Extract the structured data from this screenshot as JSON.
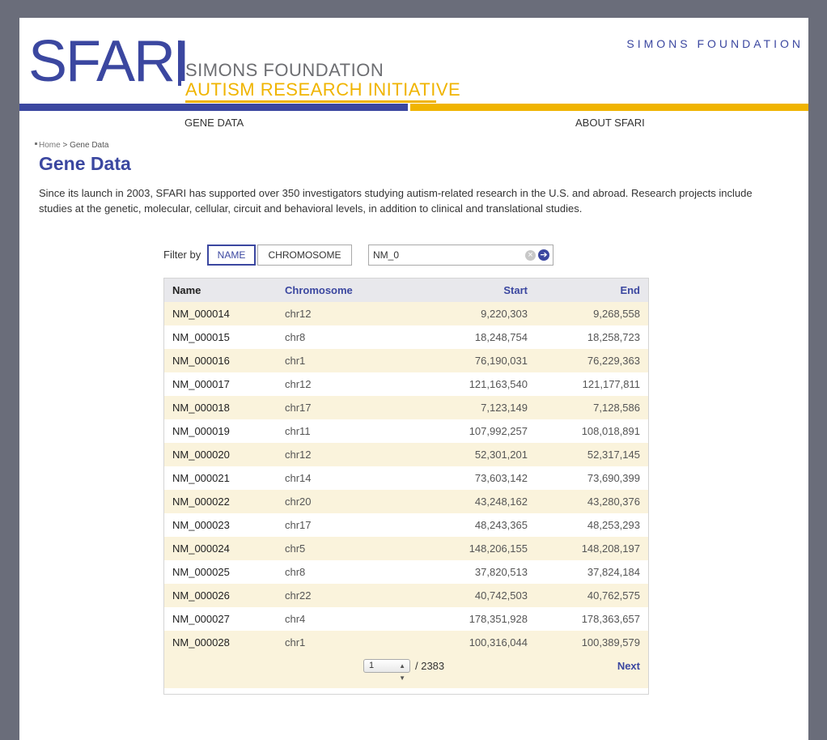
{
  "header": {
    "logo_main": "SFARI",
    "logo_line1": "SIMONS FOUNDATION",
    "logo_line2": "AUTISM RESEARCH INITIATIVE",
    "foundation_link": "SIMONS FOUNDATION",
    "nav": [
      "GENE DATA",
      "ABOUT SFARI"
    ]
  },
  "breadcrumb": {
    "home": "Home",
    "separator": " > ",
    "current": "Gene Data"
  },
  "page": {
    "title": "Gene Data",
    "intro": "Since its launch in 2003, SFARI has supported over 350 investigators studying autism-related research in the U.S. and abroad. Research projects include studies at the genetic, molecular, cellular, circuit and behavioral levels, in addition to clinical and translational studies."
  },
  "filter": {
    "label": "Filter by",
    "buttons": [
      "NAME",
      "CHROMOSOME"
    ],
    "active": "NAME",
    "search_value": "NM_0"
  },
  "table": {
    "columns": [
      "Name",
      "Chromosome",
      "Start",
      "End"
    ],
    "rows": [
      [
        "NM_000014",
        "chr12",
        "9,220,303",
        "9,268,558"
      ],
      [
        "NM_000015",
        "chr8",
        "18,248,754",
        "18,258,723"
      ],
      [
        "NM_000016",
        "chr1",
        "76,190,031",
        "76,229,363"
      ],
      [
        "NM_000017",
        "chr12",
        "121,163,540",
        "121,177,811"
      ],
      [
        "NM_000018",
        "chr17",
        "7,123,149",
        "7,128,586"
      ],
      [
        "NM_000019",
        "chr11",
        "107,992,257",
        "108,018,891"
      ],
      [
        "NM_000020",
        "chr12",
        "52,301,201",
        "52,317,145"
      ],
      [
        "NM_000021",
        "chr14",
        "73,603,142",
        "73,690,399"
      ],
      [
        "NM_000022",
        "chr20",
        "43,248,162",
        "43,280,376"
      ],
      [
        "NM_000023",
        "chr17",
        "48,243,365",
        "48,253,293"
      ],
      [
        "NM_000024",
        "chr5",
        "148,206,155",
        "148,208,197"
      ],
      [
        "NM_000025",
        "chr8",
        "37,820,513",
        "37,824,184"
      ],
      [
        "NM_000026",
        "chr22",
        "40,742,503",
        "40,762,575"
      ],
      [
        "NM_000027",
        "chr4",
        "178,351,928",
        "178,363,657"
      ],
      [
        "NM_000028",
        "chr1",
        "100,316,044",
        "100,389,579"
      ]
    ]
  },
  "pager": {
    "current_page": "1",
    "total": "/ 2383",
    "next_label": "Next"
  },
  "colors": {
    "brand_blue": "#3b47a0",
    "brand_yellow": "#f0b400",
    "row_alt": "#faf3dc"
  }
}
